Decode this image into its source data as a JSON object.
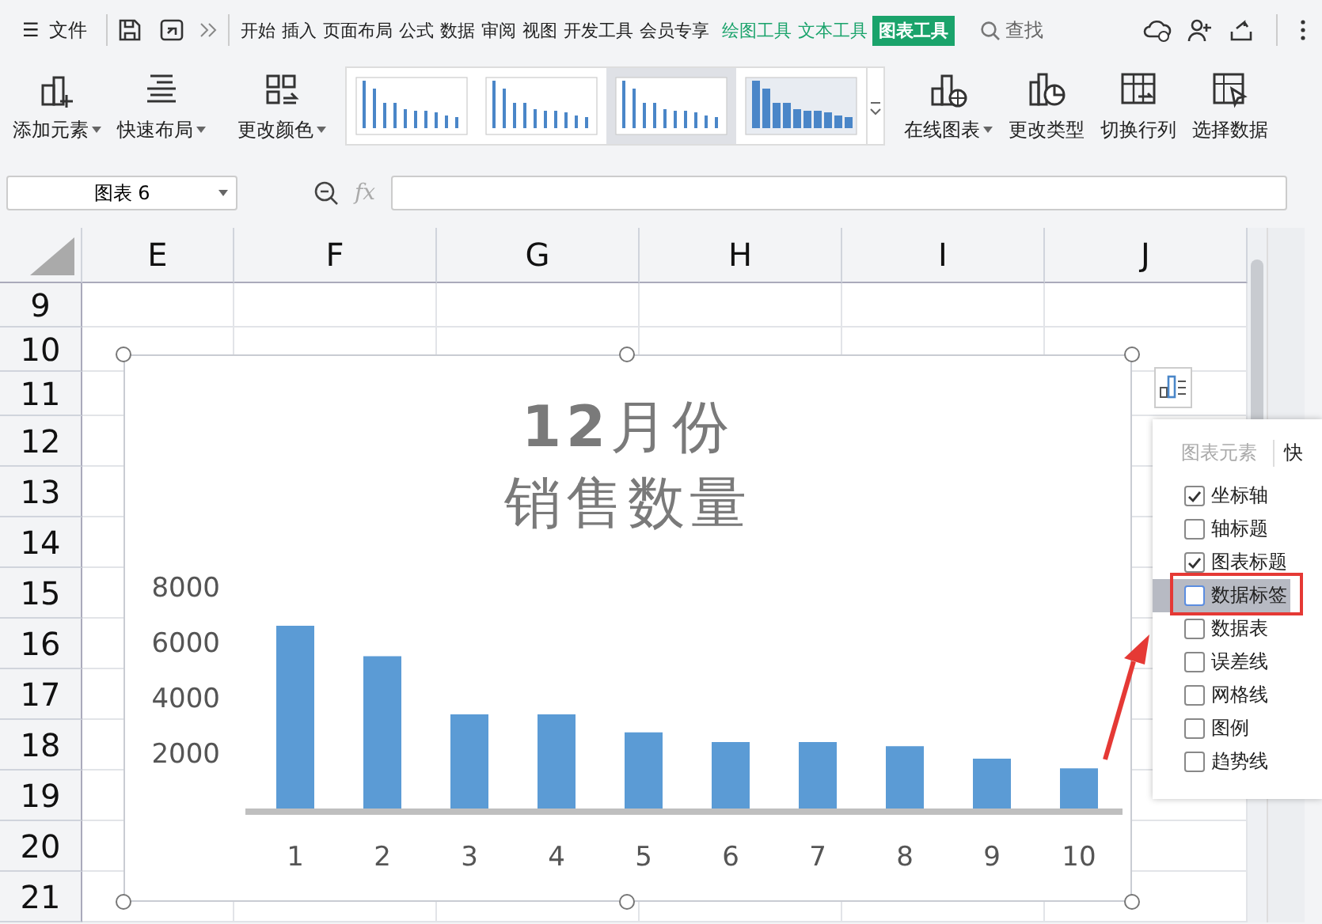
{
  "menu_bar": {
    "menu_icon": "☰",
    "file": "文件",
    "tabs": [
      {
        "label": "开始",
        "kind": "normal",
        "selected": false
      },
      {
        "label": "插入",
        "kind": "normal",
        "selected": false
      },
      {
        "label": "页面布局",
        "kind": "normal",
        "selected": false
      },
      {
        "label": "公式",
        "kind": "normal",
        "selected": false
      },
      {
        "label": "数据",
        "kind": "normal",
        "selected": false
      },
      {
        "label": "审阅",
        "kind": "normal",
        "selected": false
      },
      {
        "label": "视图",
        "kind": "normal",
        "selected": false
      },
      {
        "label": "开发工具",
        "kind": "normal",
        "selected": false
      },
      {
        "label": "会员专享",
        "kind": "normal",
        "selected": false
      },
      {
        "label": "绘图工具",
        "kind": "context",
        "selected": false
      },
      {
        "label": "文本工具",
        "kind": "context",
        "selected": false
      },
      {
        "label": "图表工具",
        "kind": "context",
        "selected": true
      }
    ],
    "search": "查找"
  },
  "ribbon": {
    "left_buttons": [
      {
        "label": "添加元素",
        "dropdown": true
      },
      {
        "label": "快速布局",
        "dropdown": true
      },
      {
        "label": "更改颜色",
        "dropdown": true
      }
    ],
    "styles": [
      {
        "selected": false
      },
      {
        "selected": false
      },
      {
        "selected": true
      },
      {
        "selected": false
      }
    ],
    "right_buttons": [
      {
        "label": "在线图表",
        "dropdown": true
      },
      {
        "label": "更改类型",
        "dropdown": false
      },
      {
        "label": "切换行列",
        "dropdown": false
      },
      {
        "label": "选择数据",
        "dropdown": false
      }
    ]
  },
  "formula_bar": {
    "name_box": "图表 6",
    "fx": "fx"
  },
  "sheet": {
    "columns": [
      "E",
      "F",
      "G",
      "H",
      "I",
      "J"
    ],
    "rows": [
      "9",
      "10",
      "11",
      "12",
      "13",
      "14",
      "15",
      "16",
      "17",
      "18",
      "19",
      "20",
      "21"
    ]
  },
  "chart": {
    "title_lines": [
      "**12**月份",
      "销售数量"
    ],
    "chart_data": {
      "type": "bar",
      "categories": [
        "1",
        "2",
        "3",
        "4",
        "5",
        "6",
        "7",
        "8",
        "9",
        "10"
      ],
      "values": [
        6600,
        5500,
        3400,
        3400,
        2750,
        2400,
        2400,
        2250,
        1800,
        1450
      ],
      "ylim": [
        0,
        8000
      ],
      "yticks": [
        2000,
        4000,
        6000,
        8000
      ]
    }
  },
  "elements_panel": {
    "tabs": [
      {
        "label": "图表元素",
        "selected": false
      },
      {
        "label": "快",
        "selected": false
      }
    ],
    "items": [
      {
        "label": "坐标轴",
        "checked": true,
        "selected": false
      },
      {
        "label": "轴标题",
        "checked": false,
        "selected": false
      },
      {
        "label": "图表标题",
        "checked": true,
        "selected": false
      },
      {
        "label": "数据标签",
        "checked": false,
        "selected": true
      },
      {
        "label": "数据表",
        "checked": false,
        "selected": false
      },
      {
        "label": "误差线",
        "checked": false,
        "selected": false
      },
      {
        "label": "网格线",
        "checked": false,
        "selected": false
      },
      {
        "label": "图例",
        "checked": false,
        "selected": false
      },
      {
        "label": "趋势线",
        "checked": false,
        "selected": false
      }
    ]
  }
}
